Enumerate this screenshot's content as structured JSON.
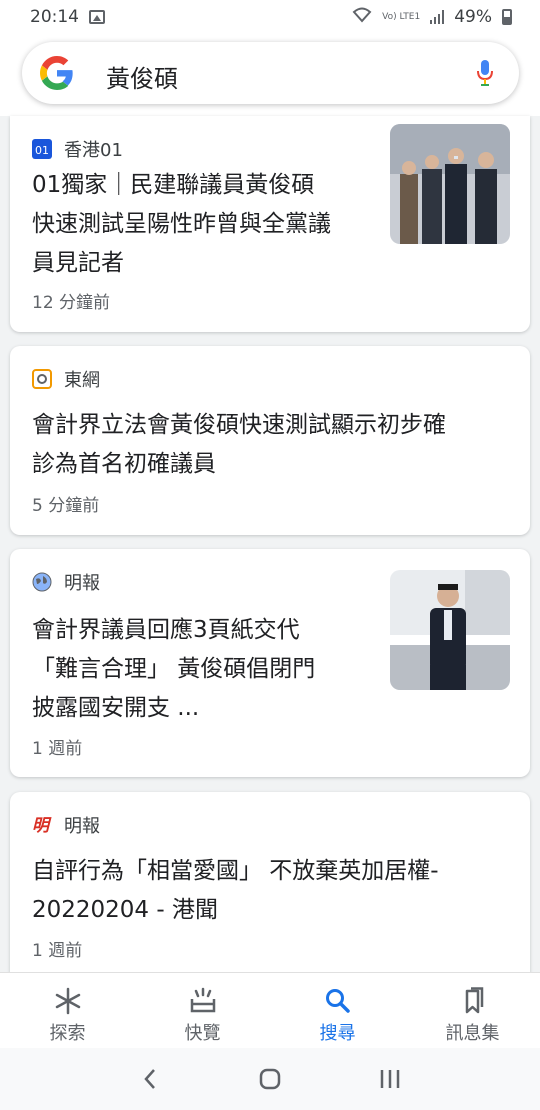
{
  "status_bar": {
    "time": "20:14",
    "network_label": "Vo) LTE1",
    "battery_percent": "49%"
  },
  "search": {
    "query": "黃俊碩"
  },
  "feed": [
    {
      "source": "香港01",
      "title_lines": [
        "01獨家｜民建聯議員黃俊碩",
        "快速測試呈陽性昨曾與全黨議",
        "員見記者"
      ],
      "time": "12 分鐘前",
      "has_thumbnail": true,
      "source_icon": "hk01-logo-icon"
    },
    {
      "source": "東網",
      "title_lines": [
        "會計界立法會黃俊碩快速測試顯示初步確",
        "診為首名初確議員"
      ],
      "time": "5 分鐘前",
      "has_thumbnail": false,
      "source_icon": "on-cc-logo-icon"
    },
    {
      "source": "明報",
      "title_lines": [
        "會計界議員回應3頁紙交代",
        "「難言合理」 黃俊碩倡閉門",
        "披露國安開支 ..."
      ],
      "time": "1 週前",
      "has_thumbnail": true,
      "source_icon": "globe-icon"
    },
    {
      "source": "明報",
      "title_lines": [
        "自評行為「相當愛國」 不放棄英加居權-",
        "20220204 - 港聞"
      ],
      "time": "1 週前",
      "has_thumbnail": false,
      "source_icon": "mingpao-logo-icon"
    }
  ],
  "bottom_nav": {
    "items": [
      {
        "label": "探索",
        "icon": "asterisk-icon",
        "active": false
      },
      {
        "label": "快覽",
        "icon": "snapshot-icon",
        "active": false
      },
      {
        "label": "搜尋",
        "icon": "search-icon",
        "active": true
      },
      {
        "label": "訊息集",
        "icon": "bookmarks-icon",
        "active": false
      }
    ]
  },
  "colors": {
    "accent": "#1a73e8",
    "background": "#f1f3f4"
  }
}
